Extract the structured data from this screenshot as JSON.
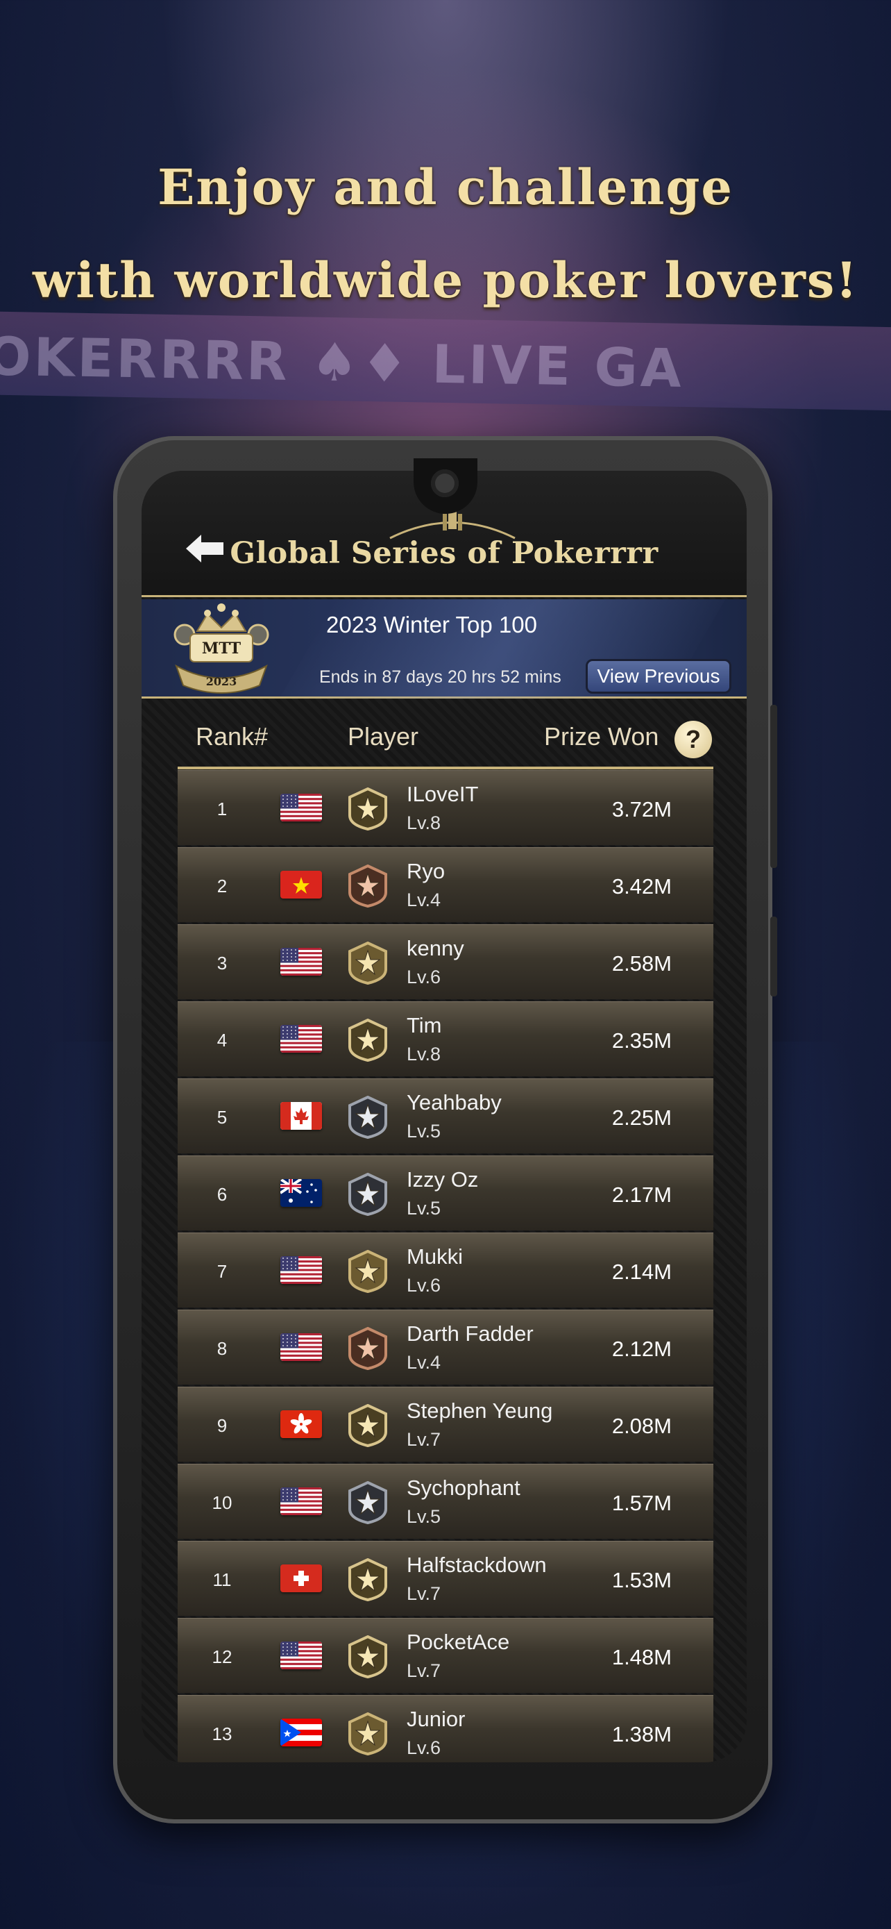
{
  "promo": {
    "line1": "Enjoy and challenge",
    "line2": "with worldwide poker lovers!",
    "bg_banner_text": "OKERRRR ♠♦ LIVE GA"
  },
  "header": {
    "title": "Global Series of Pokerrrr",
    "back_icon": "back-arrow-icon"
  },
  "season": {
    "badge_label": "MTT",
    "badge_year": "2023",
    "name": "2023 Winter Top 100",
    "ends": "Ends in 87 days 20 hrs 52 mins",
    "view_previous": "View Previous"
  },
  "columns": {
    "rank": "Rank#",
    "player": "Player",
    "prize": "Prize Won",
    "help": "?"
  },
  "colors": {
    "gold": "#c8b37a",
    "title_gold": "#e9d8a3",
    "button_blue": "#34467a"
  },
  "leaderboard": [
    {
      "rank": "1",
      "flag": "us",
      "tier": "gold-dark",
      "name": "ILoveIT",
      "level": "Lv.8",
      "prize": "3.72M"
    },
    {
      "rank": "2",
      "flag": "vn",
      "tier": "bronze",
      "name": "Ryo",
      "level": "Lv.4",
      "prize": "3.42M"
    },
    {
      "rank": "3",
      "flag": "us",
      "tier": "gold",
      "name": "kenny",
      "level": "Lv.6",
      "prize": "2.58M"
    },
    {
      "rank": "4",
      "flag": "us",
      "tier": "gold-dark",
      "name": "Tim",
      "level": "Lv.8",
      "prize": "2.35M"
    },
    {
      "rank": "5",
      "flag": "ca",
      "tier": "silver",
      "name": "Yeahbaby",
      "level": "Lv.5",
      "prize": "2.25M"
    },
    {
      "rank": "6",
      "flag": "au",
      "tier": "silver",
      "name": "Izzy Oz",
      "level": "Lv.5",
      "prize": "2.17M"
    },
    {
      "rank": "7",
      "flag": "us",
      "tier": "gold",
      "name": "Mukki",
      "level": "Lv.6",
      "prize": "2.14M"
    },
    {
      "rank": "8",
      "flag": "us",
      "tier": "bronze",
      "name": "Darth Fadder",
      "level": "Lv.4",
      "prize": "2.12M"
    },
    {
      "rank": "9",
      "flag": "hk",
      "tier": "gold-dark",
      "name": "Stephen Yeung",
      "level": "Lv.7",
      "prize": "2.08M"
    },
    {
      "rank": "10",
      "flag": "us",
      "tier": "silver",
      "name": "Sychophant",
      "level": "Lv.5",
      "prize": "1.57M"
    },
    {
      "rank": "11",
      "flag": "ch",
      "tier": "gold-dark",
      "name": "Halfstackdown",
      "level": "Lv.7",
      "prize": "1.53M"
    },
    {
      "rank": "12",
      "flag": "us",
      "tier": "gold-dark",
      "name": "PocketAce",
      "level": "Lv.7",
      "prize": "1.48M"
    },
    {
      "rank": "13",
      "flag": "pr",
      "tier": "gold",
      "name": "Junior",
      "level": "Lv.6",
      "prize": "1.38M"
    }
  ]
}
